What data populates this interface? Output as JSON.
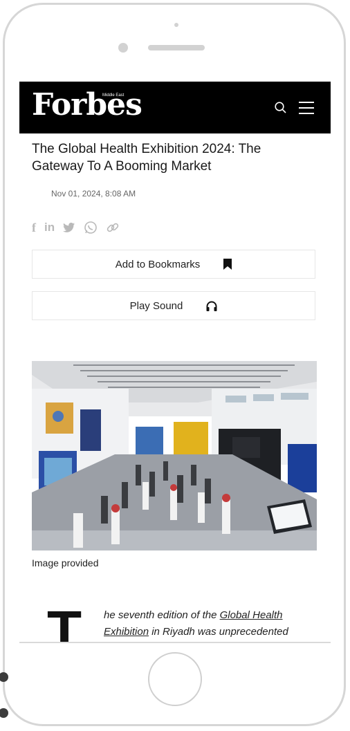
{
  "header": {
    "logo": "Forbes",
    "logo_sub": "Middle East",
    "icons": [
      "search-icon",
      "menu-icon"
    ]
  },
  "article": {
    "title": "The Global Health Exhibition 2024: The Gateway To A Booming Market",
    "date": "Nov 01, 2024, 8:08 AM",
    "share_icons": [
      "facebook-icon",
      "linkedin-icon",
      "twitter-icon",
      "whatsapp-icon",
      "link-icon"
    ],
    "bookmark_label": "Add to Bookmarks",
    "sound_label": "Play Sound",
    "image_caption": "Image provided",
    "dropcap": "T",
    "para_start": "he seventh edition of the ",
    "para_link1": "Global Health",
    "para_link2": "Exhibition",
    "para_end": " in Riyadh was unprecedented"
  },
  "colors": {
    "header_bg": "#000000",
    "share_icon": "#b9b9b9"
  }
}
